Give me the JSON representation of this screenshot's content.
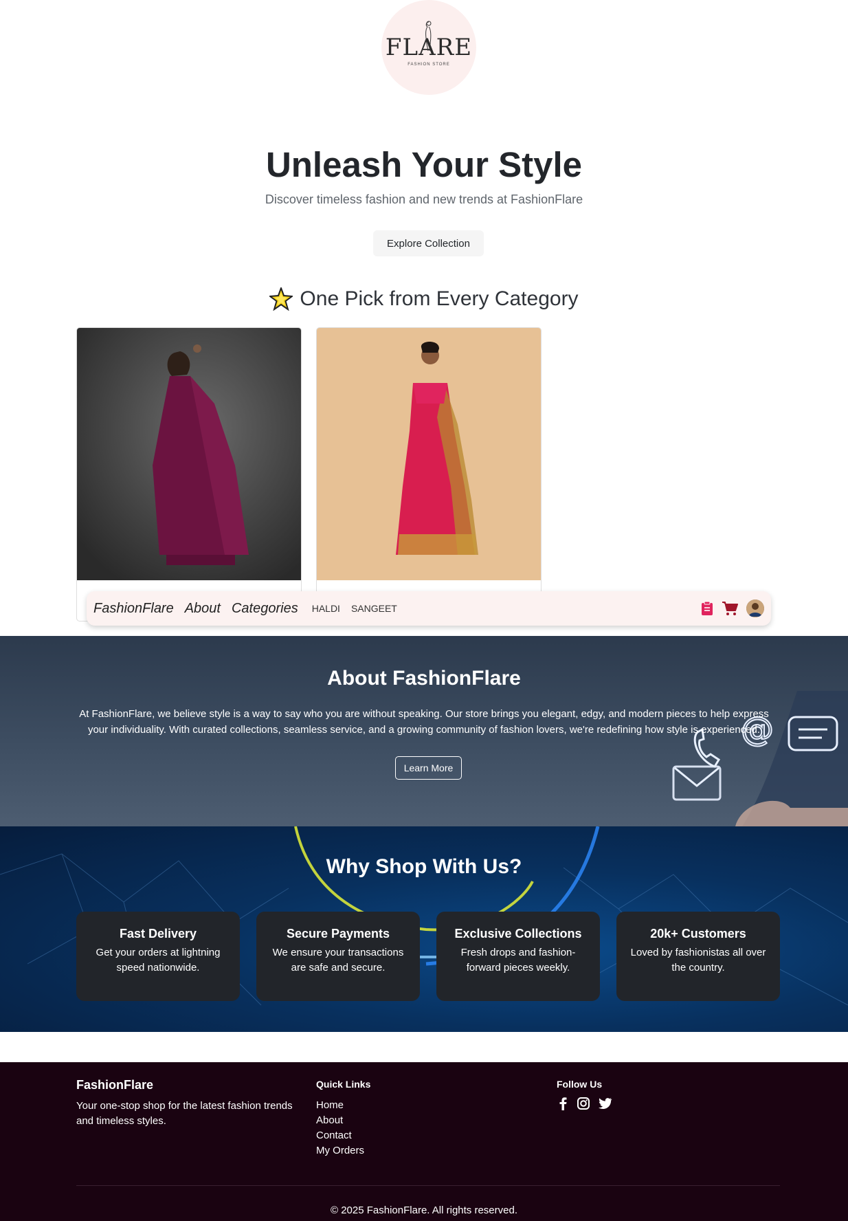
{
  "logo": {
    "wordmark": "FLARE",
    "tagline": "FASHION STORE"
  },
  "hero": {
    "title": "Unleash Your Style",
    "subtitle": "Discover timeless fashion and new trends at FashionFlare",
    "cta_label": "Explore Collection"
  },
  "picks": {
    "title": "One Pick from Every Category",
    "icon": "star-icon"
  },
  "navbar": {
    "brand": "FashionFlare",
    "links": [
      "About",
      "Categories"
    ],
    "categories": [
      "HALDI",
      "SANGEET"
    ]
  },
  "about": {
    "title": "About FashionFlare",
    "text": "At FashionFlare, we believe style is a way to say who you are without speaking. Our store brings you elegant, edgy, and modern pieces to help express your individuality. With curated collections, seamless service, and a growing community of fashion lovers, we're redefining how style is experienced.",
    "cta_label": "Learn More"
  },
  "why": {
    "title": "Why Shop With Us?",
    "features": [
      {
        "title": "Fast Delivery",
        "text": "Get your orders at lightning speed nationwide."
      },
      {
        "title": "Secure Payments",
        "text": "We ensure your transactions are safe and secure."
      },
      {
        "title": "Exclusive Collections",
        "text": "Fresh drops and fashion-forward pieces weekly."
      },
      {
        "title": "20k+ Customers",
        "text": "Loved by fashionistas all over the country."
      }
    ]
  },
  "footer": {
    "brand": "FashionFlare",
    "description": "Your one-stop shop for the latest fashion trends and timeless styles.",
    "quick_links_title": "Quick Links",
    "quick_links": [
      "Home",
      "About",
      "Contact",
      "My Orders"
    ],
    "follow_title": "Follow Us",
    "social_icons": [
      "facebook-icon",
      "instagram-icon",
      "twitter-icon"
    ],
    "copyright": "© 2025 FashionFlare. All rights reserved."
  },
  "colors": {
    "accent": "#e0245e",
    "cart": "#a0162b",
    "footer_bg": "#1a0311",
    "card_dark": "#22252a"
  }
}
